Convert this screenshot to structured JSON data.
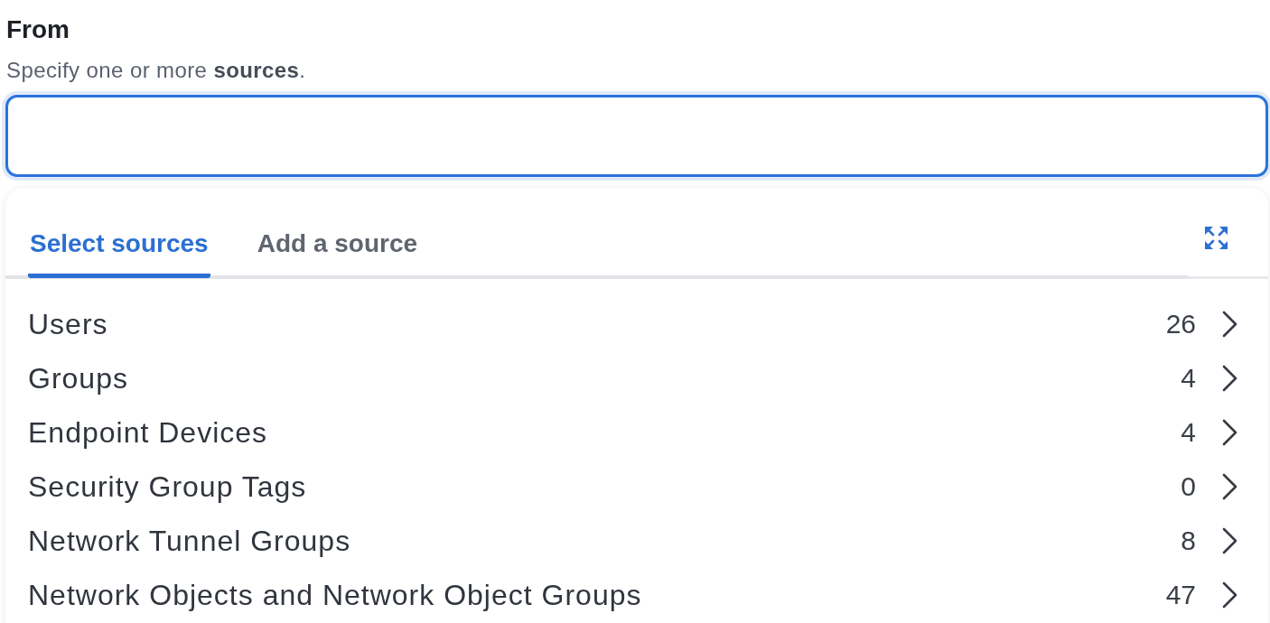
{
  "field": {
    "label": "From",
    "description": "Specify one or more **sources**.",
    "focused": true
  },
  "dropdown": {
    "tabs": [
      {
        "label": "Select sources",
        "selected": true
      },
      {
        "label": "Add a source",
        "selected": false
      }
    ],
    "items": [
      {
        "label": "Users",
        "count": "26"
      },
      {
        "label": "Groups",
        "count": "4"
      },
      {
        "label": "Endpoint Devices",
        "count": "4"
      },
      {
        "label": "Security Group Tags",
        "count": "0"
      },
      {
        "label": "Network Tunnel Groups",
        "count": "8"
      },
      {
        "label": "Network Objects and Network Object Groups",
        "count": "47"
      }
    ]
  }
}
